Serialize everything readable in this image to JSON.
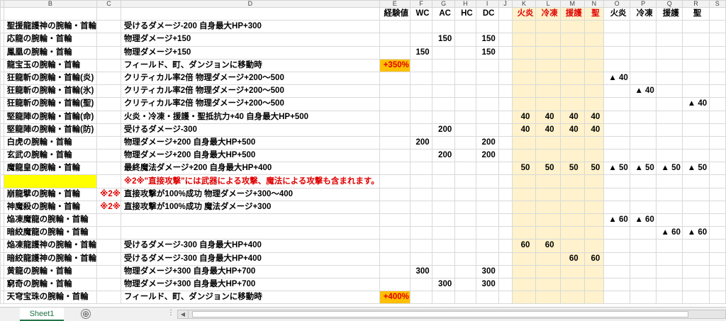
{
  "columns": [
    "B",
    "C",
    "D",
    "E",
    "F",
    "G",
    "H",
    "I",
    "J",
    "K",
    "L",
    "M",
    "N",
    "O",
    "P",
    "Q",
    "R",
    "S"
  ],
  "selected_column": "S",
  "header_row": [
    "",
    "",
    "",
    "経験値",
    "WC",
    "AC",
    "HC",
    "DC",
    "",
    "火炎",
    "冷凍",
    "援護",
    "聖",
    "火炎",
    "冷凍",
    "援護",
    "聖",
    ""
  ],
  "rows": [
    {
      "B": "聖援龍護神の腕輪・首輪",
      "D": "受けるダメージ-200 自身最大HP+300"
    },
    {
      "B": "応龍の腕輪・首輪",
      "D": "物理ダメージ+150",
      "G": "150",
      "I": "150"
    },
    {
      "B": "鳳凰の腕輪・首輪",
      "D": "物理ダメージ+150",
      "F": "150",
      "I": "150"
    },
    {
      "B": "龍宝玉の腕輪・首輪",
      "D": "フィールド、町、ダンジョンに移動時",
      "E": "+350%"
    },
    {
      "B": "狂龍斬の腕輪・首輪(炎)",
      "D": "クリティカル率2倍 物理ダメージ+200～500",
      "O": "▲ 40"
    },
    {
      "B": "狂龍斬の腕輪・首輪(氷)",
      "D": "クリティカル率2倍 物理ダメージ+200～500",
      "P": "▲ 40"
    },
    {
      "B": "狂龍斬の腕輪・首輪(聖)",
      "D": "クリティカル率2倍 物理ダメージ+200～500",
      "R": "▲ 40"
    },
    {
      "B": "堅龍陣の腕輪・首輪(命)",
      "D": "火炎・冷凍・援護・聖抵抗力+40 自身最大HP+500",
      "K": "40",
      "L": "40",
      "M": "40",
      "N": "40"
    },
    {
      "B": "堅龍陣の腕輪・首輪(防)",
      "D": "受けるダメージ-300",
      "G": "200",
      "K": "40",
      "L": "40",
      "M": "40",
      "N": "40"
    },
    {
      "B": "白虎の腕輪・首輪",
      "D": "物理ダメージ+200 自身最大HP+500",
      "F": "200",
      "I": "200"
    },
    {
      "B": "玄武の腕輪・首輪",
      "D": "物理ダメージ+200 自身最大HP+500",
      "G": "200",
      "I": "200"
    },
    {
      "B": "魔龍皇の腕輪・首輪",
      "D": "最終魔法ダメージ+200 自身最大HP+400",
      "K": "50",
      "L": "50",
      "M": "50",
      "N": "50",
      "O": "▲ 50",
      "P": "▲ 50",
      "Q": "▲ 50",
      "R": "▲ 50"
    },
    {
      "B": "",
      "D": "※2※\"直接攻撃\"には武器による攻撃、魔法による攻撃も含まれます。"
    },
    {
      "B": "崩龍擘の腕輪・首輪",
      "C": "※2※",
      "D": "直接攻撃が100%成功 物理ダメージ+300～400"
    },
    {
      "B": "神魔殺の腕輪・首輪",
      "C": "※2※",
      "D": "直接攻撃が100%成功 魔法ダメージ+300"
    },
    {
      "B": "焔凍魔龍の腕輪・首輪",
      "O": "▲ 60",
      "P": "▲ 60"
    },
    {
      "B": "暗絞魔龍の腕輪・首輪",
      "Q": "▲ 60",
      "R": "▲ 60"
    },
    {
      "B": "焔凍龍護神の腕輪・首輪",
      "D": "受けるダメージ-300 自身最大HP+400",
      "K": "60",
      "L": "60"
    },
    {
      "B": "暗絞龍護神の腕輪・首輪",
      "D": "受けるダメージ-300 自身最大HP+400",
      "M": "60",
      "N": "60"
    },
    {
      "B": "黄龍の腕輪・首輪",
      "D": "物理ダメージ+300 自身最大HP+700",
      "F": "300",
      "I": "300"
    },
    {
      "B": "窮奇の腕輪・首輪",
      "D": "物理ダメージ+300 自身最大HP+700",
      "G": "300",
      "I": "300"
    },
    {
      "B": "天穹宝珠の腕輪・首輪",
      "D": "フィールド、町、ダンジョンに移動時",
      "E": "+400%"
    }
  ],
  "sheet_tab": "Sheet1",
  "add_sheet_glyph": "⊕",
  "separator_glyph": "⋮",
  "scroll_left_glyph": "◀"
}
